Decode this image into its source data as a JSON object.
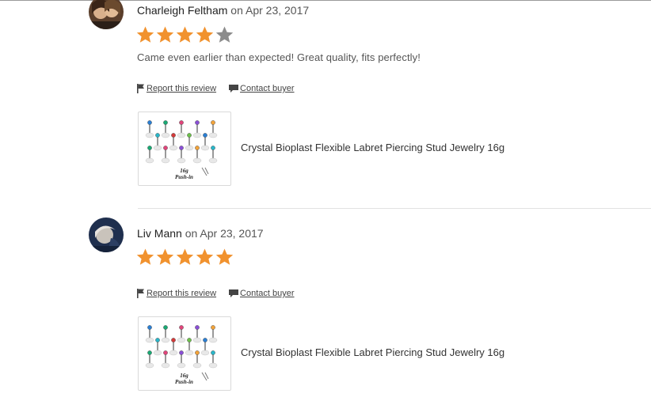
{
  "colors": {
    "star_filled": "#f1922e",
    "star_empty": "#8c8c8c",
    "divider": "#e1e1e1"
  },
  "reviews": [
    {
      "avatar_icon": "user-avatar-photo",
      "name": "Charleigh Feltham",
      "date_prefix": "on",
      "date": "Apr 23, 2017",
      "rating": 4,
      "max_rating": 5,
      "text": "Came even earlier than expected! Great quality, fits perfectly!",
      "report_label": "Report this review",
      "contact_label": "Contact buyer",
      "product_title": "Crystal Bioplast Flexible Labret Piercing Stud Jewelry 16g",
      "product_image_caption": "16g\nPush-in"
    },
    {
      "avatar_icon": "user-avatar-photo",
      "name": "Liv Mann",
      "date_prefix": "on",
      "date": "Apr 23, 2017",
      "rating": 5,
      "max_rating": 5,
      "text": "",
      "report_label": "Report this review",
      "contact_label": "Contact buyer",
      "product_title": "Crystal Bioplast Flexible Labret Piercing Stud Jewelry 16g",
      "product_image_caption": "16g\nPush-in"
    }
  ]
}
